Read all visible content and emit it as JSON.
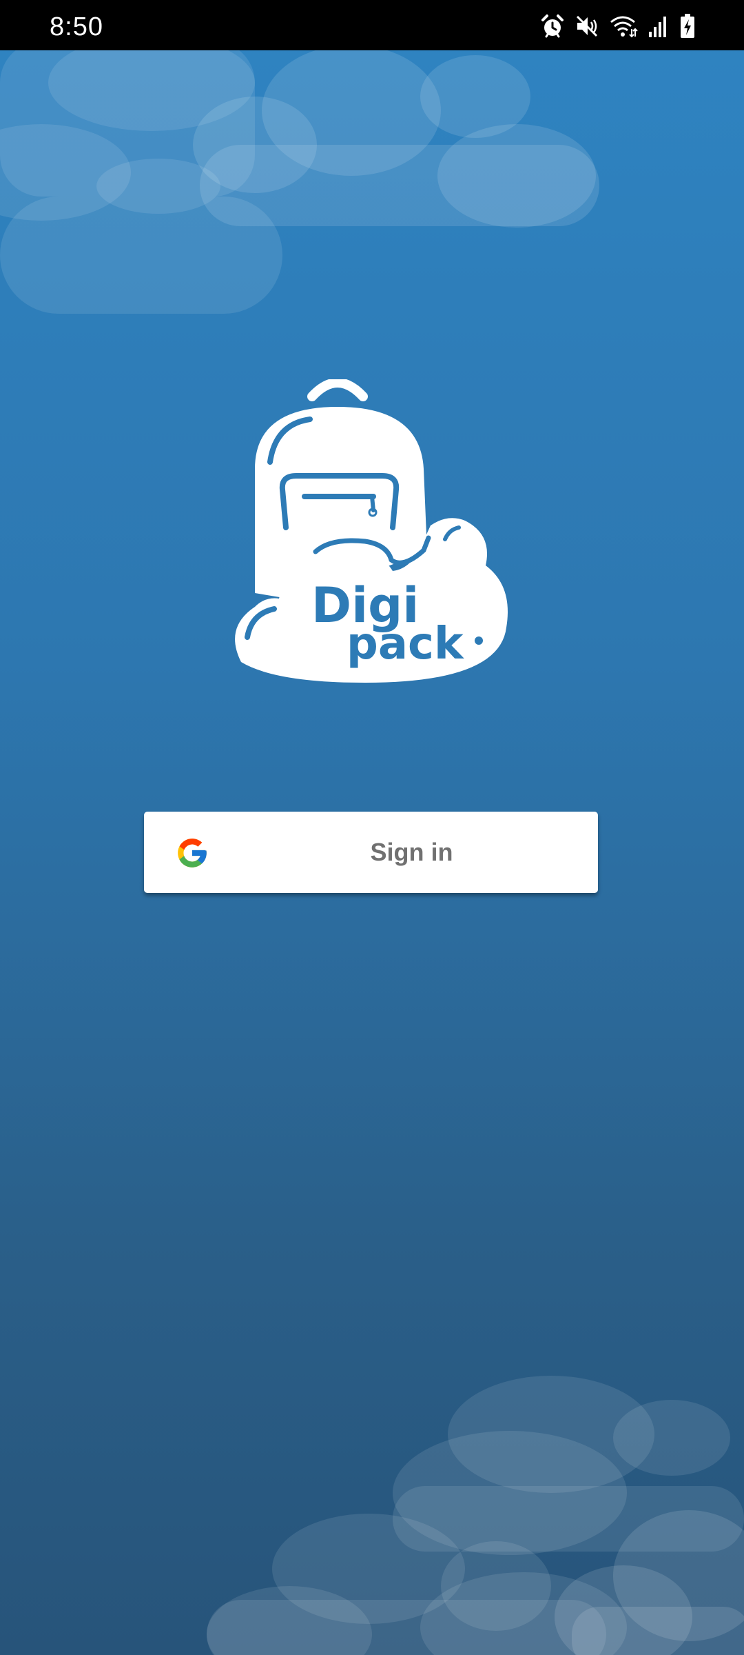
{
  "status_bar": {
    "time": "8:50",
    "icons": [
      "alarm-icon",
      "mute-icon",
      "wifi-icon",
      "signal-icon",
      "battery-charging-icon"
    ]
  },
  "app": {
    "name": "Digi pack",
    "logo_line1": "Digi",
    "logo_line2": "pack"
  },
  "signin": {
    "label": "Sign in",
    "provider_icon": "google-icon"
  },
  "colors": {
    "background_top": "#2f84c2",
    "background_bottom": "#27547a",
    "button_bg": "#ffffff",
    "button_text": "#707070",
    "logo": "#ffffff"
  }
}
